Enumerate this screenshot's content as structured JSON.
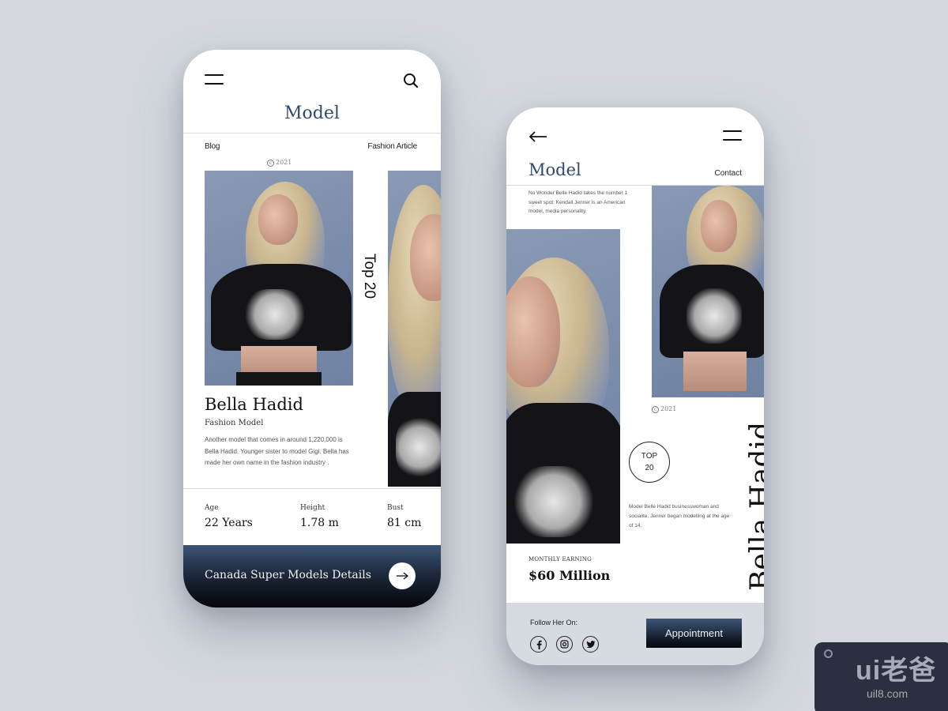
{
  "screen1": {
    "title": "Model",
    "nav_left": "Blog",
    "nav_right": "Fashion Article",
    "copyright_symbol": "c",
    "copyright_year": "2021",
    "vertical_label": "Top 20",
    "name": "Bella Hadid",
    "role": "Fashion Model",
    "description": "Another model that comes in around 1,220,000 is Bella Hadid. Younger sister to model Gigi. Bella has made her own name in the fashion industry .",
    "stats": [
      {
        "label": "Age",
        "value": "22 Years"
      },
      {
        "label": "Height",
        "value": "1.78 m"
      },
      {
        "label": "Bust",
        "value": "81 cm"
      }
    ],
    "footer_label": "Canada Super Models Details",
    "icons": {
      "menu": "hamburger-icon",
      "search": "search-icon",
      "next": "arrow-right-icon"
    }
  },
  "screen2": {
    "title": "Model",
    "contact": "Contact",
    "intro": "No Wonder Belle Hadid takes the number 1 sweet spot. Kendall Jenner is an American model, media personality.",
    "copyright_symbol": "c",
    "copyright_year": "2021",
    "badge_line1": "TOP",
    "badge_line2": "20",
    "description": "Model Belle Hadid businesswoman and socialite. Jenner began modelling at the age of 14.",
    "earning_label": "MONTHLY EARNING",
    "earning_value": "$60 Million",
    "name_vertical": "Bella Hadid",
    "follow_label": "Follow Her On:",
    "socials": [
      "facebook",
      "instagram",
      "twitter"
    ],
    "appointment_label": "Appointment",
    "icons": {
      "back": "arrow-left-icon",
      "menu": "hamburger-icon"
    }
  },
  "watermark": {
    "logo": "ui老爸",
    "url": "uil8.com"
  },
  "colors": {
    "background": "#d4d8de",
    "accent_title": "#2e4a70",
    "footer_dark": "#1b2638",
    "footer_light": "#d6dae1"
  }
}
